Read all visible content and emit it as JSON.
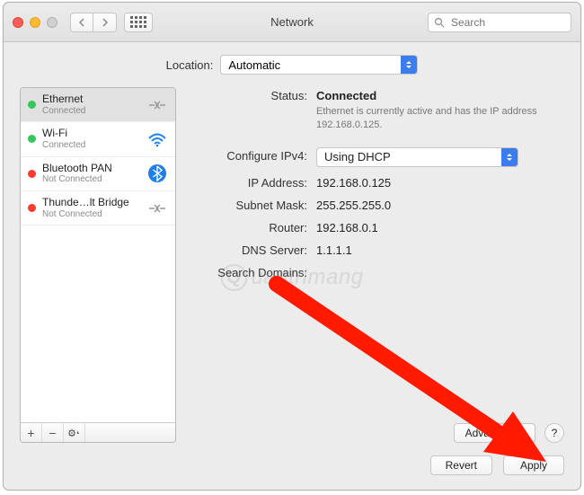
{
  "window": {
    "title": "Network"
  },
  "search": {
    "placeholder": "Search"
  },
  "location": {
    "label": "Location:",
    "value": "Automatic"
  },
  "sidebar": {
    "items": [
      {
        "name": "Ethernet",
        "status": "Connected"
      },
      {
        "name": "Wi-Fi",
        "status": "Connected"
      },
      {
        "name": "Bluetooth PAN",
        "status": "Not Connected"
      },
      {
        "name": "Thunde…lt Bridge",
        "status": "Not Connected"
      }
    ]
  },
  "details": {
    "status_label": "Status:",
    "status_value": "Connected",
    "status_sub": "Ethernet is currently active and has the IP address 192.168.0.125.",
    "configure_label": "Configure IPv4:",
    "configure_value": "Using DHCP",
    "ip_label": "IP Address:",
    "ip_value": "192.168.0.125",
    "subnet_label": "Subnet Mask:",
    "subnet_value": "255.255.255.0",
    "router_label": "Router:",
    "router_value": "192.168.0.1",
    "dns_label": "DNS Server:",
    "dns_value": "1.1.1.1",
    "search_domains_label": "Search Domains:"
  },
  "buttons": {
    "advanced": "Advanced…",
    "help": "?",
    "revert": "Revert",
    "apply": "Apply"
  },
  "watermark": "uantrimang"
}
